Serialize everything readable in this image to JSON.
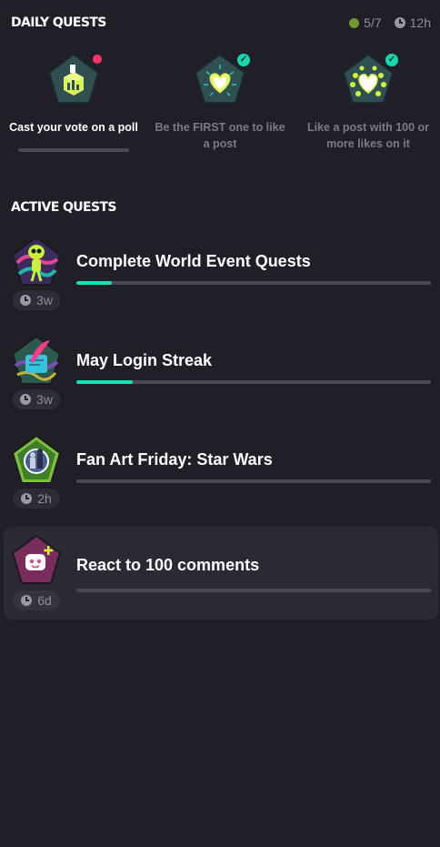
{
  "daily": {
    "title": "DAILY QUESTS",
    "completed": "5/7",
    "time_left": "12h",
    "quests": [
      {
        "label": "Cast your vote on a poll",
        "status": "in-progress",
        "icon": "ballot-box-icon",
        "progress": 0
      },
      {
        "label": "Be the FIRST one to like a post",
        "status": "completed",
        "icon": "glowing-heart-icon"
      },
      {
        "label": "Like a post with 100 or more likes on it",
        "status": "completed",
        "icon": "hearts-cluster-icon"
      }
    ]
  },
  "active": {
    "title": "ACTIVE QUESTS",
    "quests": [
      {
        "title": "Complete World Event Quests",
        "time": "3w",
        "progress": 0.1,
        "icon": "alien-character-icon"
      },
      {
        "title": "May Login Streak",
        "time": "3w",
        "progress": 0.16,
        "icon": "quill-scroll-icon"
      },
      {
        "title": "Fan Art Friday: Star Wars",
        "time": "2h",
        "progress": 0,
        "icon": "star-wars-art-icon"
      },
      {
        "title": "React to 100 comments",
        "time": "6d",
        "progress": 0,
        "icon": "comment-reaction-icon"
      }
    ]
  },
  "colors": {
    "background": "#201e26",
    "progress_fill": "#15e3b4",
    "progress_track": "#4a4852",
    "notification": "#ff3366"
  }
}
